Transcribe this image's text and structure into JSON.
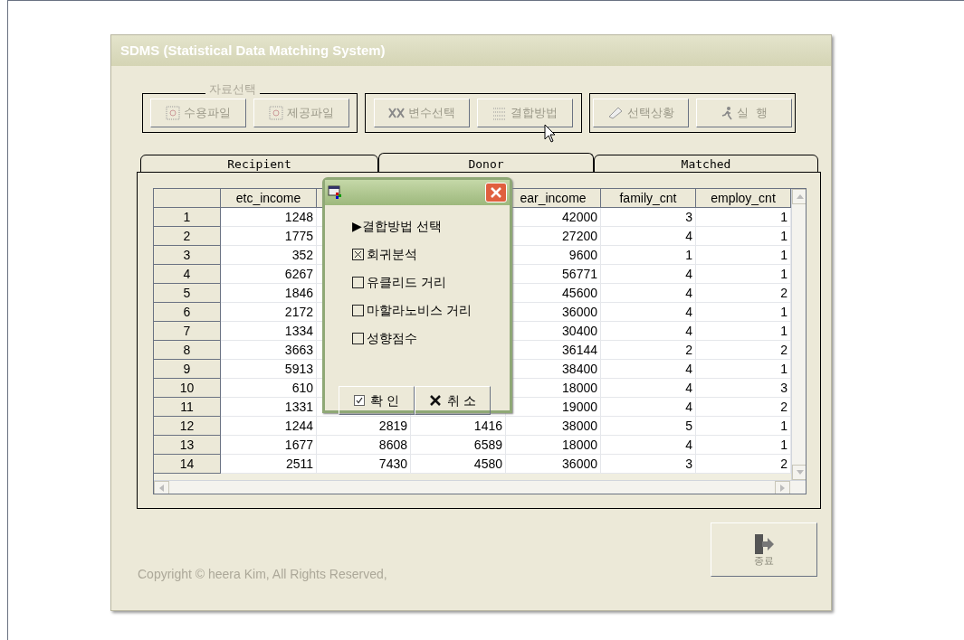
{
  "window": {
    "title": "SDMS (Statistical Data Matching System)"
  },
  "toolbar": {
    "group_label": "자료선택",
    "groups": [
      [
        {
          "label": "수용파일",
          "disabled": true
        },
        {
          "label": "제공파일",
          "disabled": true
        }
      ],
      [
        {
          "label": "변수선택",
          "disabled": true
        },
        {
          "label": "결합방법",
          "disabled": true
        }
      ],
      [
        {
          "label": "선택상황",
          "disabled": true
        },
        {
          "label": "실  행",
          "disabled": true
        }
      ]
    ]
  },
  "tabs": [
    {
      "label": "Recipient",
      "selected": false
    },
    {
      "label": "Donor",
      "selected": true
    },
    {
      "label": "Matched",
      "selected": false
    }
  ],
  "table": {
    "columns": [
      "etc_income",
      null,
      null,
      "ear_income",
      "family_cnt",
      "employ_cnt"
    ],
    "rows": [
      {
        "num": "1",
        "cells": [
          "1248",
          null,
          null,
          "42000",
          "3",
          "1"
        ]
      },
      {
        "num": "2",
        "cells": [
          "1775",
          null,
          null,
          "27200",
          "4",
          "1"
        ]
      },
      {
        "num": "3",
        "cells": [
          "352",
          null,
          null,
          "9600",
          "1",
          "1"
        ]
      },
      {
        "num": "4",
        "cells": [
          "6267",
          null,
          null,
          "56771",
          "4",
          "1"
        ]
      },
      {
        "num": "5",
        "cells": [
          "1846",
          null,
          null,
          "45600",
          "4",
          "2"
        ]
      },
      {
        "num": "6",
        "cells": [
          "2172",
          null,
          null,
          "36000",
          "4",
          "1"
        ]
      },
      {
        "num": "7",
        "cells": [
          "1334",
          null,
          null,
          "30400",
          "4",
          "1"
        ]
      },
      {
        "num": "8",
        "cells": [
          "3663",
          null,
          null,
          "36144",
          "2",
          "2"
        ]
      },
      {
        "num": "9",
        "cells": [
          "5913",
          null,
          null,
          "38400",
          "4",
          "1"
        ]
      },
      {
        "num": "10",
        "cells": [
          "610",
          null,
          null,
          "18000",
          "4",
          "3"
        ]
      },
      {
        "num": "11",
        "cells": [
          "1331",
          null,
          null,
          "19000",
          "4",
          "2"
        ]
      },
      {
        "num": "12",
        "cells": [
          "1244",
          "2819",
          "1416",
          "38000",
          "5",
          "1"
        ]
      },
      {
        "num": "13",
        "cells": [
          "1677",
          "8608",
          "6589",
          "18000",
          "4",
          "1"
        ]
      },
      {
        "num": "14",
        "cells": [
          "2511",
          "7430",
          "4580",
          "36000",
          "3",
          "2"
        ]
      }
    ]
  },
  "dialog": {
    "heading": "▶결합방법 선택",
    "options": [
      {
        "label": "회귀분석",
        "checked": true
      },
      {
        "label": "유클리드 거리",
        "checked": false
      },
      {
        "label": "마할라노비스 거리",
        "checked": false
      },
      {
        "label": "성향점수",
        "checked": false
      }
    ],
    "ok": "확 인",
    "cancel": "취 소"
  },
  "exit_button": {
    "label": "종료",
    "disabled": true
  },
  "copyright": "Copyright © heera Kim, All Rights Reserved,"
}
